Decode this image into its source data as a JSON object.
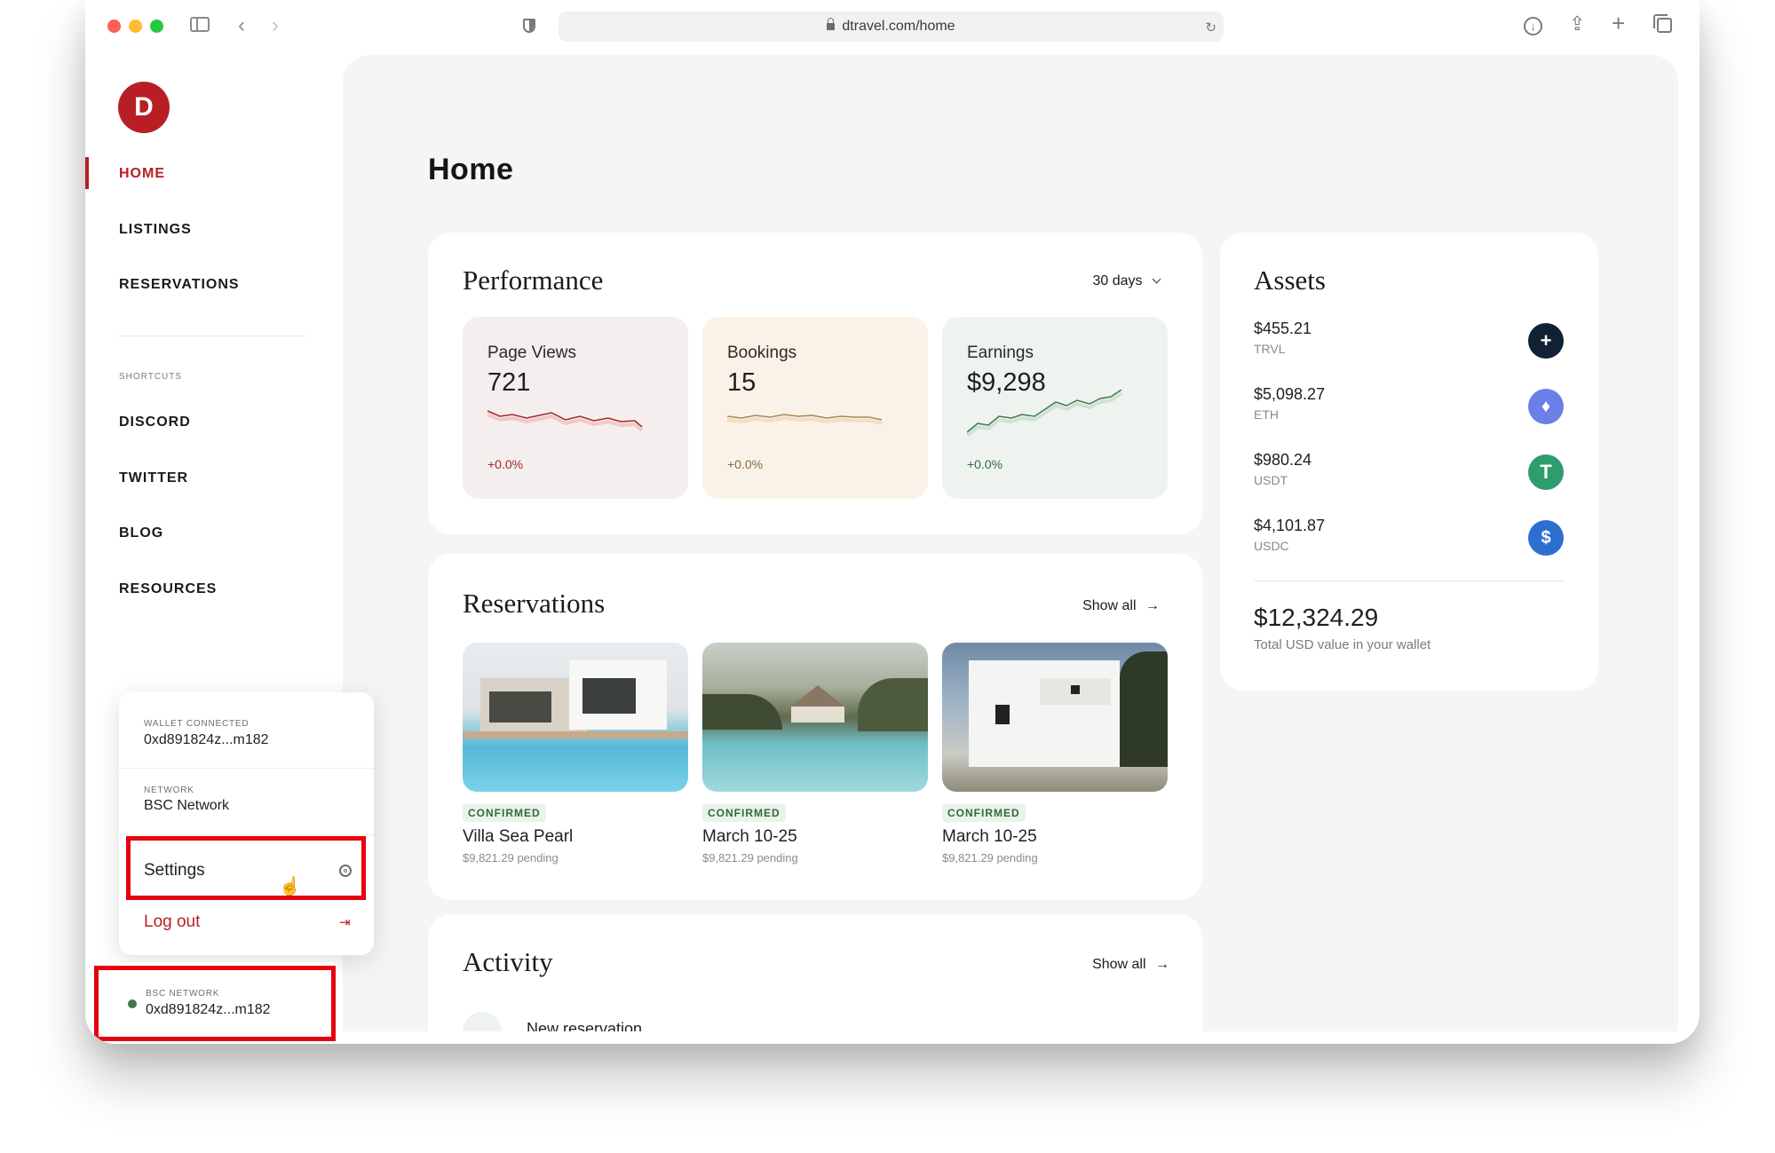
{
  "browser": {
    "url": "dtravel.com/home"
  },
  "sidebar": {
    "logo_letter": "D",
    "nav": [
      {
        "label": "HOME"
      },
      {
        "label": "LISTINGS"
      },
      {
        "label": "RESERVATIONS"
      }
    ],
    "shortcuts_heading": "SHORTCUTS",
    "shortcuts": [
      {
        "label": "DISCORD"
      },
      {
        "label": "TWITTER"
      },
      {
        "label": "BLOG"
      },
      {
        "label": "RESOURCES"
      }
    ]
  },
  "wallet_menu": {
    "wallet_label": "WALLET CONNECTED",
    "wallet_address": "0xd891824z...m182",
    "network_label": "NETWORK",
    "network_value": "BSC Network",
    "settings_label": "Settings",
    "logout_label": "Log out"
  },
  "wallet_footer": {
    "network_label": "BSC NETWORK",
    "address": "0xd891824z...m182"
  },
  "main": {
    "page_title": "Home",
    "performance": {
      "title": "Performance",
      "range": "30 days",
      "metrics": [
        {
          "label": "Page Views",
          "value": "721",
          "change": "+0.0%",
          "color": "#9b2c2c",
          "bg": "#f5eeee"
        },
        {
          "label": "Bookings",
          "value": "15",
          "change": "+0.0%",
          "color": "#8a6b3d",
          "bg": "#fbf2e7"
        },
        {
          "label": "Earnings",
          "value": "$9,298",
          "change": "+0.0%",
          "color": "#2f6b3d",
          "bg": "#eef3ef"
        }
      ]
    },
    "reservations": {
      "title": "Reservations",
      "show_all": "Show all",
      "items": [
        {
          "status": "CONFIRMED",
          "name": "Villa Sea Pearl",
          "pending": "$9,821.29 pending"
        },
        {
          "status": "CONFIRMED",
          "name": "March 10-25",
          "pending": "$9,821.29 pending"
        },
        {
          "status": "CONFIRMED",
          "name": "March 10-25",
          "pending": "$9,821.29 pending"
        }
      ]
    },
    "activity": {
      "title": "Activity",
      "show_all": "Show all",
      "first_item": "New reservation"
    },
    "assets": {
      "title": "Assets",
      "items": [
        {
          "value": "$455.21",
          "ticker": "TRVL",
          "icon": "trvl-icon",
          "color": "#0f2133"
        },
        {
          "value": "$5,098.27",
          "ticker": "ETH",
          "icon": "eth-icon",
          "color": "#6b7fe8"
        },
        {
          "value": "$980.24",
          "ticker": "USDT",
          "icon": "usdt-icon",
          "color": "#2d9d6d"
        },
        {
          "value": "$4,101.87",
          "ticker": "USDC",
          "icon": "usdc-icon",
          "color": "#2b6fd1"
        }
      ],
      "total": "$12,324.29",
      "total_label": "Total USD value in your wallet"
    }
  }
}
